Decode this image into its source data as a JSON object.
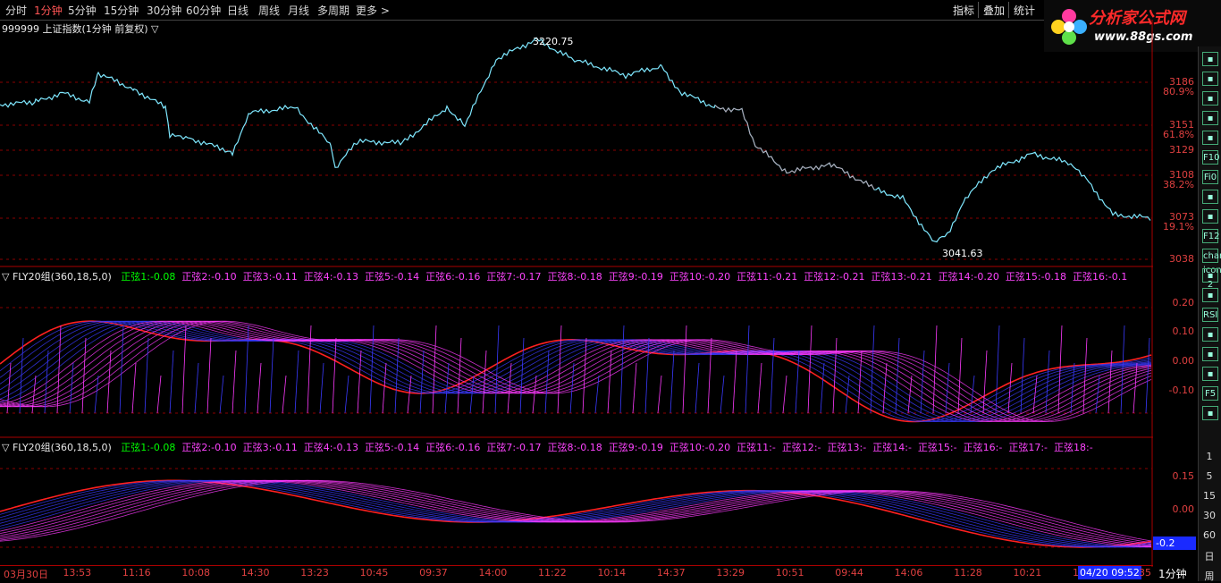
{
  "toolbar": {
    "timeframes": [
      "分时",
      "1分钟",
      "5分钟",
      "15分钟",
      "30分钟",
      "60分钟",
      "日线",
      "周线",
      "月线",
      "多周期",
      "更多 >"
    ],
    "active_index": 1,
    "right_buttons": [
      "指标",
      "叠加",
      "统计"
    ]
  },
  "logo": {
    "title": "分析家公式网",
    "url": "www.88gs.com"
  },
  "chart_data": [
    {
      "type": "line",
      "title": "999999 上证指数(1分钟 前复权) ▽",
      "annotations": [
        {
          "label": "3220.75",
          "kind": "high"
        },
        {
          "label": "3041.63",
          "kind": "low"
        }
      ],
      "y_ticks": [
        {
          "value": "3186",
          "pct": "80.9%"
        },
        {
          "value": "3151",
          "pct": "61.8%"
        },
        {
          "value": "3129",
          "pct": ""
        },
        {
          "value": "3108",
          "pct": "38.2%"
        },
        {
          "value": "3073",
          "pct": "19.1%"
        },
        {
          "value": "3038",
          "pct": ""
        }
      ],
      "ylim": [
        3030,
        3230
      ]
    },
    {
      "type": "line",
      "title": "▽ FLY20组(360,18,5,0)",
      "legend": [
        {
          "name": "正弦1",
          "value": "-0.08",
          "color": "#00ff00"
        },
        {
          "name": "正弦2",
          "value": "-0.10"
        },
        {
          "name": "正弦3",
          "value": "-0.11"
        },
        {
          "name": "正弦4",
          "value": "-0.13"
        },
        {
          "name": "正弦5",
          "value": "-0.14"
        },
        {
          "name": "正弦6",
          "value": "-0.16"
        },
        {
          "name": "正弦7",
          "value": "-0.17"
        },
        {
          "name": "正弦8",
          "value": "-0.18"
        },
        {
          "name": "正弦9",
          "value": "-0.19"
        },
        {
          "name": "正弦10",
          "value": "-0.20"
        },
        {
          "name": "正弦11",
          "value": "-0.21"
        },
        {
          "name": "正弦12",
          "value": "-0.21"
        },
        {
          "name": "正弦13",
          "value": "-0.21"
        },
        {
          "name": "正弦14",
          "value": "-0.20"
        },
        {
          "name": "正弦15",
          "value": "-0.18"
        },
        {
          "name": "正弦16",
          "value": "-0.1"
        }
      ],
      "y_ticks": [
        "0.20",
        "0.10",
        "0.00",
        "-0.10"
      ],
      "ylim": [
        -0.25,
        0.25
      ]
    },
    {
      "type": "line",
      "title": "▽ FLY20组(360,18,5,0)",
      "legend": [
        {
          "name": "正弦1",
          "value": "-0.08",
          "color": "#00ff00"
        },
        {
          "name": "正弦2",
          "value": "-0.10"
        },
        {
          "name": "正弦3",
          "value": "-0.11"
        },
        {
          "name": "正弦4",
          "value": "-0.13"
        },
        {
          "name": "正弦5",
          "value": "-0.14"
        },
        {
          "name": "正弦6",
          "value": "-0.16"
        },
        {
          "name": "正弦7",
          "value": "-0.17"
        },
        {
          "name": "正弦8",
          "value": "-0.18"
        },
        {
          "name": "正弦9",
          "value": "-0.19"
        },
        {
          "name": "正弦10",
          "value": "-0.20"
        },
        {
          "name": "正弦11",
          "value": "-"
        },
        {
          "name": "正弦12",
          "value": "-"
        },
        {
          "name": "正弦13",
          "value": "-"
        },
        {
          "name": "正弦14",
          "value": "-"
        },
        {
          "name": "正弦15",
          "value": "-"
        },
        {
          "name": "正弦16",
          "value": "-"
        },
        {
          "name": "正弦17",
          "value": "-"
        },
        {
          "name": "正弦18",
          "value": "-"
        }
      ],
      "y_ticks": [
        "0.15",
        "0.00",
        "-0.15"
      ],
      "current_value": "-0.2",
      "ylim": [
        -0.25,
        0.25
      ]
    }
  ],
  "x_axis": {
    "ticks": [
      "03月30日",
      "13:53",
      "11:16",
      "10:08",
      "14:30",
      "13:23",
      "10:45",
      "09:37",
      "14:00",
      "11:22",
      "10:14",
      "14:37",
      "13:29",
      "10:51",
      "09:44",
      "14:06",
      "11:28",
      "10:21",
      "14"
    ],
    "cursor_time": "04/20 09:52",
    "tail": "35",
    "period": "1分钟"
  },
  "sidebar": {
    "icons": [
      "list-icon",
      "grid-icon",
      "trend-icon",
      "candle-icon",
      "window-icon",
      "F10",
      "Fi0",
      "report-icon",
      "chart-icon",
      "F12",
      "chart-icon-2",
      "circle-icon",
      "line-icon",
      "RSI",
      "sort-icon",
      "move-icon",
      "pencil-icon",
      "F5",
      "calendar-icon"
    ],
    "numbers": [
      "1",
      "5",
      "15",
      "30",
      "60",
      "日",
      "周"
    ]
  }
}
